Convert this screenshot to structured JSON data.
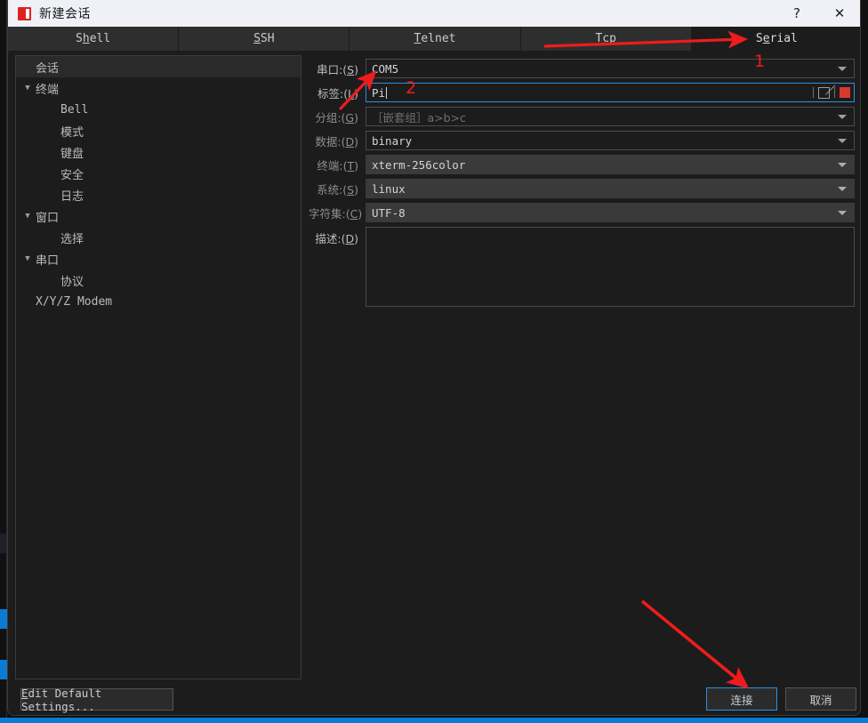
{
  "window": {
    "title": "新建会话",
    "icon": "app-square-icon",
    "help_label": "?",
    "close_label": "✕"
  },
  "tabs": [
    {
      "label_pre": "S",
      "label_underline": "h",
      "label_post": "ell",
      "full": "Shell",
      "active": false
    },
    {
      "label_pre": "",
      "label_underline": "S",
      "label_post": "SH",
      "full": "SSH",
      "active": false
    },
    {
      "label_pre": "",
      "label_underline": "T",
      "label_post": "elnet",
      "full": "Telnet",
      "active": false
    },
    {
      "label_pre": "T",
      "label_underline": "c",
      "label_post": "p",
      "full": "Tcp",
      "active": false
    },
    {
      "label_pre": "S",
      "label_underline": "e",
      "label_post": "rial",
      "full": "Serial",
      "active": true
    }
  ],
  "sidebar": {
    "items": [
      {
        "label": "会话",
        "indent": 1,
        "twisty": "",
        "selected": true,
        "cn": true
      },
      {
        "label": "终端",
        "indent": 0,
        "twisty": "▼",
        "selected": false,
        "cn": true
      },
      {
        "label": "Bell",
        "indent": 2,
        "twisty": "",
        "selected": false,
        "cn": false
      },
      {
        "label": "模式",
        "indent": 2,
        "twisty": "",
        "selected": false,
        "cn": true
      },
      {
        "label": "键盘",
        "indent": 2,
        "twisty": "",
        "selected": false,
        "cn": true
      },
      {
        "label": "安全",
        "indent": 2,
        "twisty": "",
        "selected": false,
        "cn": true
      },
      {
        "label": "日志",
        "indent": 2,
        "twisty": "",
        "selected": false,
        "cn": true
      },
      {
        "label": "窗口",
        "indent": 0,
        "twisty": "▼",
        "selected": false,
        "cn": true
      },
      {
        "label": "选择",
        "indent": 2,
        "twisty": "",
        "selected": false,
        "cn": true
      },
      {
        "label": "串口",
        "indent": 0,
        "twisty": "▼",
        "selected": false,
        "cn": true
      },
      {
        "label": "协议",
        "indent": 2,
        "twisty": "",
        "selected": false,
        "cn": true
      },
      {
        "label": "X/Y/Z Modem",
        "indent": 1,
        "twisty": "",
        "selected": false,
        "cn": false
      }
    ]
  },
  "form": {
    "fields": [
      {
        "label_pre": "串口:(",
        "label_key": "S",
        "label_post": ")",
        "value": "COM5",
        "placeholder": "",
        "style": "bordered",
        "dropdown": true,
        "dim_label": false
      },
      {
        "label_pre": "标签:(",
        "label_key": "L",
        "label_post": ")",
        "value": "Pi",
        "placeholder": "",
        "style": "focused",
        "dropdown": false,
        "dim_label": false
      },
      {
        "label_pre": "分组:(",
        "label_key": "G",
        "label_post": ")",
        "value": "",
        "placeholder": "［嵌套组］a>b>c",
        "style": "bordered",
        "dropdown": true,
        "dim_label": true
      },
      {
        "label_pre": "数据:(",
        "label_key": "D",
        "label_post": ")",
        "value": "binary",
        "placeholder": "",
        "style": "bordered",
        "dropdown": true,
        "dim_label": true
      },
      {
        "label_pre": "终端:(",
        "label_key": "T",
        "label_post": ")",
        "value": "xterm-256color",
        "placeholder": "",
        "style": "filled",
        "dropdown": true,
        "dim_label": true
      },
      {
        "label_pre": "系统:(",
        "label_key": "S",
        "label_post": ")",
        "value": "linux",
        "placeholder": "",
        "style": "filled",
        "dropdown": true,
        "dim_label": true
      },
      {
        "label_pre": "字符集:(",
        "label_key": "C",
        "label_post": ")",
        "value": "UTF-8",
        "placeholder": "",
        "style": "filled",
        "dropdown": true,
        "dim_label": true
      }
    ],
    "label_tools": {
      "edit_icon": "crossed-box-icon",
      "color_swatch": "#d83a2a"
    },
    "description": {
      "label_pre": "描述:(",
      "label_key": "D",
      "label_post": ")",
      "value": ""
    }
  },
  "footer": {
    "edit_defaults_pre": "E",
    "edit_defaults_post": "dit Default Settings...",
    "connect_label": "连接",
    "cancel_label": "取消"
  },
  "annotations": {
    "marker_1": "1",
    "marker_2": "2",
    "arrow_color": "#ee1c1c"
  }
}
